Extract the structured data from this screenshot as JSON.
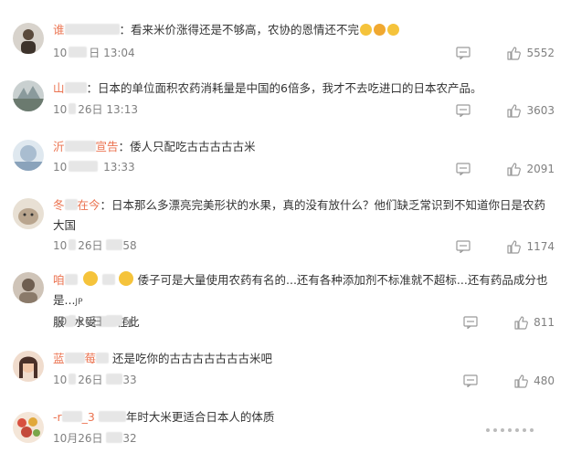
{
  "comments": [
    {
      "user": "谁",
      "date_prefix": "10",
      "time": "13:04",
      "text": "看来米价涨得还是不够高，农协的恩情还不完",
      "likes": "5552",
      "avatar_color": "#6b5a4a"
    },
    {
      "user": "山",
      "date_prefix": "10",
      "date_suffix": "26日",
      "time": "13:13",
      "text": "日本的单位面积农药消耗量是中国的6倍多，我才不去吃进口的日本农产品。",
      "likes": "3603",
      "avatar_color": "#7c8a8c"
    },
    {
      "user": "沂",
      "user_suffix": "宣告",
      "date_prefix": "10",
      "time": "13:33",
      "text": "倭人只配吃古古古古古米",
      "likes": "2091",
      "avatar_color": "#9fb3c8"
    },
    {
      "user": "冬",
      "user_suffix": "在今",
      "date_prefix": "10",
      "date_suffix": "26日",
      "time": "58",
      "text": "日本那么多漂亮完美形状的水果，真的没有放什么？他们缺乏常识到不知道你日是农药大国",
      "likes": "1174",
      "avatar_color": "#b9a58e"
    },
    {
      "user": "咱",
      "date_prefix": "10",
      "date_suffix": "26日",
      "time": "56",
      "text": "倭子可是大量使用农药有名的...还有各种添加剂不标准就不超标...还有药品成分也是...",
      "text_tail": "JP",
      "text_line2": "服",
      "text_line2b": "水受",
      "text_line2c": "在此",
      "likes": "811",
      "avatar_color": "#8a7a6a"
    },
    {
      "user": "蓝",
      "user_suffix": "莓",
      "date_prefix": "10",
      "date_suffix": "26日",
      "time": "33",
      "text": "还是吃你的古古古古古古古米吧",
      "likes": "480",
      "avatar_color": "#c9a08a"
    },
    {
      "user": "-r",
      "user_suffix": "_3",
      "date_prefix": "10月26日",
      "time": "32",
      "text": "陈",
      "text_rest": "年时大米更适合日本人的体质",
      "likes": "",
      "avatar_color": "#c44a3a"
    }
  ],
  "colors": {
    "name": "#eb7350",
    "meta": "#808080",
    "text": "#333333",
    "icon": "#9a9a9a"
  }
}
